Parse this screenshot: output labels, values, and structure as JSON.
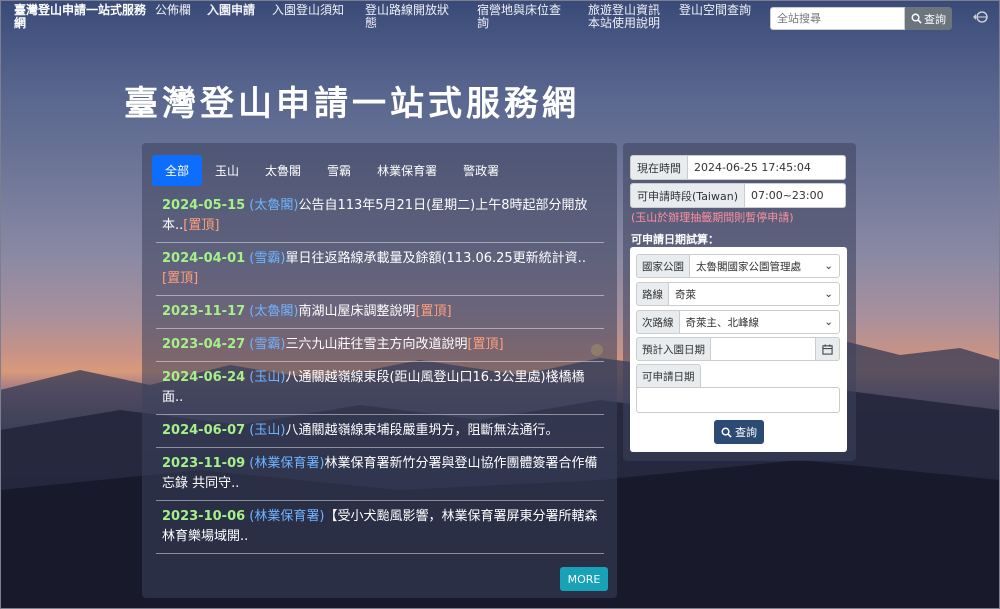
{
  "nav": {
    "brand": "臺灣登山申請一站式服務網",
    "items": [
      {
        "label": "公佈欄"
      },
      {
        "label": "入園申請"
      },
      {
        "label": "入園登山須知"
      },
      {
        "label": "登山路線開放狀態"
      },
      {
        "label": "宿營地與床位查詢"
      },
      {
        "label": "旅遊登山資訊本站使用說明"
      },
      {
        "label": "登山空間查詢"
      }
    ],
    "search_placeholder": "全站搜尋",
    "search_button": "查詢",
    "search_icon": "search-icon",
    "lang_icon": "globe-icon"
  },
  "page_title": "臺灣登山申請一站式服務網",
  "news": {
    "tabs": [
      {
        "label": "全部",
        "active": true
      },
      {
        "label": "玉山"
      },
      {
        "label": "太魯閣"
      },
      {
        "label": "雪霸"
      },
      {
        "label": "林業保育署"
      },
      {
        "label": "警政署"
      }
    ],
    "items": [
      {
        "date": "2024-05-15",
        "cat": "(太魯閣)",
        "text": "公告自113年5月21日(星期二)上午8時起部分開放本..",
        "pin": "[置頂]"
      },
      {
        "date": "2024-04-01",
        "cat": "(雪霸)",
        "text": "單日往返路線承載量及餘額(113.06.25更新統計資..",
        "pin": "[置頂]"
      },
      {
        "date": "2023-11-17",
        "cat": "(太魯閣)",
        "text": "南湖山屋床調整說明",
        "pin": "[置頂]"
      },
      {
        "date": "2023-04-27",
        "cat": "(雪霸)",
        "text": "三六九山莊往雪主方向改道說明",
        "pin": "[置頂]"
      },
      {
        "date": "2024-06-24",
        "cat": "(玉山)",
        "text": "八通關越嶺線東段(距山風登山口16.3公里處)棧橋橋面..",
        "pin": ""
      },
      {
        "date": "2024-06-07",
        "cat": "(玉山)",
        "text": "八通關越嶺線東埔段嚴重坍方，阻斷無法通行。",
        "pin": ""
      },
      {
        "date": "2023-11-09",
        "cat": "(林業保育署)",
        "text": "林業保育署新竹分署與登山協作團體簽署合作備忘錄 共同守..",
        "pin": ""
      },
      {
        "date": "2023-10-06",
        "cat": "(林業保育署)",
        "text": "【受小犬颱風影響，林業保育署屏東分署所轄森林育樂場域開..",
        "pin": ""
      }
    ],
    "more_label": "MORE"
  },
  "side": {
    "time_label": "現在時間",
    "time_value": "2024-06-25 17:45:04",
    "period_label": "可申請時段(Taiwan)",
    "period_value": "07:00~23:00",
    "note": "(玉山於辦理抽籤期間則暫停申請)",
    "calc_title": "可申請日期試算：",
    "park_label": "國家公園",
    "park_value": "太魯閣國家公園管理處",
    "route_label": "路線",
    "route_value": "奇萊",
    "subroute_label": "次路線",
    "subroute_value": "奇萊主、北峰線",
    "entry_label": "預計入園日期",
    "apply_label": "可申請日期",
    "query_button": "查詢"
  }
}
